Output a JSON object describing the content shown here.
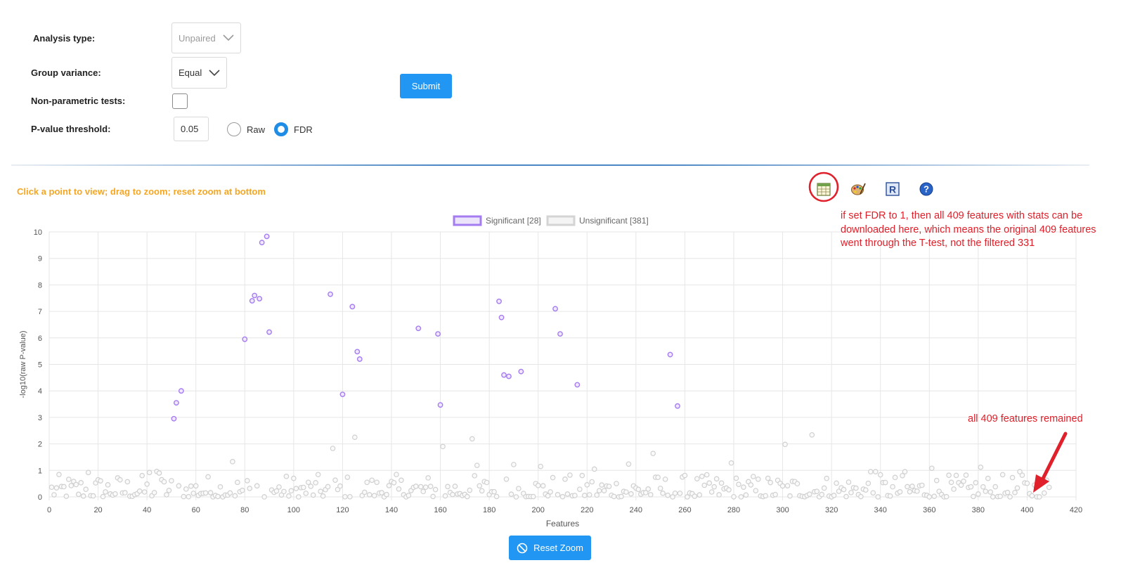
{
  "form": {
    "analysis_type_label": "Analysis type:",
    "analysis_type_value": "Unpaired",
    "group_variance_label": "Group variance:",
    "group_variance_value": "Equal",
    "nonparam_label": "Non-parametric tests:",
    "pvalue_label": "P-value threshold:",
    "pvalue_value": "0.05",
    "radio_raw": "Raw",
    "radio_fdr": "FDR",
    "selected_radio": "FDR",
    "submit_label": "Submit"
  },
  "hint": "Click a point to view; drag to zoom; reset zoom at bottom",
  "toolbar": {
    "icons": [
      "table-icon",
      "palette-icon",
      "r-script-icon",
      "help-icon"
    ]
  },
  "annotations": {
    "note_lines": [
      "if set FDR to 1, then all 409 features with stats can be",
      "downloaded here, which means the original 409 features",
      "went through the T-test, not the filtered 331"
    ],
    "arrow_note": "all 409 features remained",
    "color": "#e0202a"
  },
  "reset_zoom_label": "Reset Zoom",
  "colors": {
    "significant": "#a57cf0",
    "unsignificant": "#d0d0d0",
    "primary": "#2196f3",
    "hint": "#f5a623"
  },
  "chart_data": {
    "type": "scatter",
    "xlabel": "Features",
    "ylabel": "-log10(raw P-value)",
    "xlim": [
      0,
      420
    ],
    "ylim": [
      0,
      10
    ],
    "x_ticks": [
      0,
      20,
      40,
      60,
      80,
      100,
      120,
      140,
      160,
      180,
      200,
      220,
      240,
      260,
      280,
      300,
      320,
      340,
      360,
      380,
      400,
      420
    ],
    "y_ticks": [
      0,
      1,
      2,
      3,
      4,
      5,
      6,
      7,
      8,
      9,
      10
    ],
    "grid": true,
    "legend_position": "top-center",
    "series": [
      {
        "name": "Significant [28]",
        "color": "#a57cf0",
        "points": [
          [
            51,
            2.95
          ],
          [
            52,
            3.55
          ],
          [
            54,
            4.0
          ],
          [
            80,
            5.95
          ],
          [
            83,
            7.4
          ],
          [
            84,
            7.6
          ],
          [
            86,
            7.48
          ],
          [
            87,
            9.6
          ],
          [
            89,
            9.83
          ],
          [
            90,
            6.22
          ],
          [
            115,
            7.65
          ],
          [
            120,
            3.87
          ],
          [
            124,
            7.18
          ],
          [
            126,
            5.48
          ],
          [
            127,
            5.2
          ],
          [
            151,
            6.36
          ],
          [
            159,
            6.15
          ],
          [
            160,
            3.47
          ],
          [
            184,
            7.38
          ],
          [
            185,
            6.77
          ],
          [
            186,
            4.6
          ],
          [
            188,
            4.55
          ],
          [
            193,
            4.73
          ],
          [
            207,
            7.1
          ],
          [
            209,
            6.15
          ],
          [
            216,
            4.23
          ],
          [
            254,
            5.37
          ],
          [
            257,
            3.43
          ]
        ]
      },
      {
        "name": "Unsignificant [381]",
        "color": "#d0d0d0",
        "points": [
          [
            75,
            1.33
          ],
          [
            116,
            1.83
          ],
          [
            125,
            2.25
          ],
          [
            161,
            1.9
          ],
          [
            173,
            2.19
          ],
          [
            175,
            1.19
          ],
          [
            190,
            1.22
          ],
          [
            201,
            1.15
          ],
          [
            223,
            1.05
          ],
          [
            237,
            1.24
          ],
          [
            247,
            1.64
          ],
          [
            279,
            1.28
          ],
          [
            301,
            1.98
          ],
          [
            312,
            2.34
          ],
          [
            336,
            0.95
          ],
          [
            338,
            0.95
          ],
          [
            350,
            0.95
          ],
          [
            361,
            1.08
          ],
          [
            381,
            1.12
          ],
          [
            397,
            0.95
          ],
          [
            16,
            0.92
          ],
          [
            41,
            0.92
          ],
          [
            44,
            0.96
          ],
          [
            45,
            0.9
          ]
        ]
      }
    ]
  }
}
